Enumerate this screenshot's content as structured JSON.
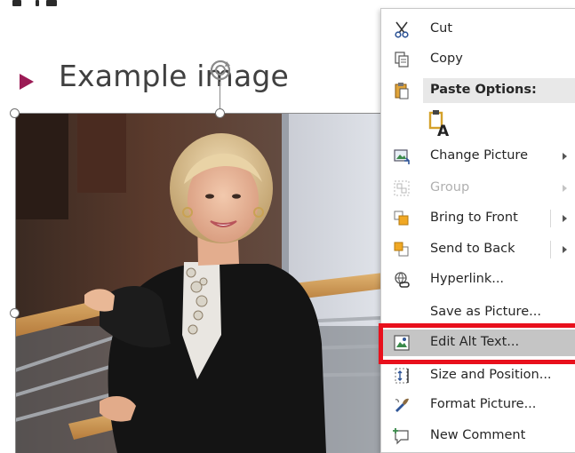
{
  "slide": {
    "title": "Example image"
  },
  "context_menu": {
    "items": [
      {
        "id": "cut",
        "label": "Cut",
        "icon": "scissors-icon",
        "submenu": false,
        "enabled": true
      },
      {
        "id": "copy",
        "label": "Copy",
        "icon": "copy-icon",
        "submenu": false,
        "enabled": true
      },
      {
        "id": "change-picture",
        "label": "Change Picture",
        "icon": "change-picture-icon",
        "submenu": true,
        "enabled": true
      },
      {
        "id": "group",
        "label": "Group",
        "icon": "group-icon",
        "submenu": true,
        "enabled": false
      },
      {
        "id": "bring-to-front",
        "label": "Bring to Front",
        "icon": "bring-to-front-icon",
        "submenu": true,
        "enabled": true
      },
      {
        "id": "send-to-back",
        "label": "Send to Back",
        "icon": "send-to-back-icon",
        "submenu": true,
        "enabled": true
      },
      {
        "id": "hyperlink",
        "label": "Hyperlink...",
        "icon": "hyperlink-icon",
        "submenu": false,
        "enabled": true
      },
      {
        "id": "save-as-picture",
        "label": "Save as Picture...",
        "icon": "",
        "submenu": false,
        "enabled": true
      },
      {
        "id": "edit-alt-text",
        "label": "Edit Alt Text...",
        "icon": "alt-text-icon",
        "submenu": false,
        "enabled": true,
        "highlighted": true
      },
      {
        "id": "size-and-position",
        "label": "Size and Position...",
        "icon": "size-position-icon",
        "submenu": false,
        "enabled": true
      },
      {
        "id": "format-picture",
        "label": "Format Picture...",
        "icon": "format-picture-icon",
        "submenu": false,
        "enabled": true
      },
      {
        "id": "new-comment",
        "label": "New Comment",
        "icon": "new-comment-icon",
        "submenu": false,
        "enabled": true
      }
    ],
    "paste_options_header": "Paste Options:",
    "paste_option_icon": "keep-text-only-icon"
  },
  "colors": {
    "bullet": "#9b1b55",
    "title_text": "#404040",
    "menu_highlight": "#c5c5c5",
    "callout_border": "#e8101c",
    "header_bg": "#e8e8e8"
  }
}
